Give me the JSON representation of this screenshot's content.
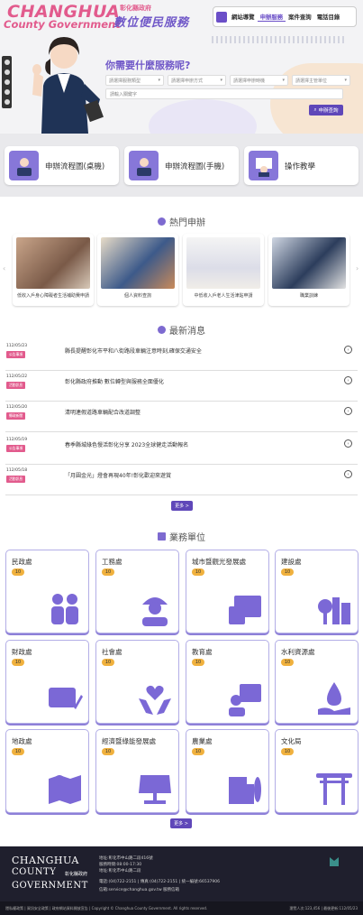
{
  "header": {
    "logo_en_line1": "CHANGHUA",
    "logo_en_line2": "County Government",
    "logo_zh_small": "彰化縣政府",
    "logo_zh_big": "數位便民服務",
    "nav": [
      "網站導覽",
      "申辦服務",
      "案件查詢",
      "電話目錄"
    ]
  },
  "search": {
    "question": "你需要什麼服務呢?",
    "selects": [
      "請選擇服務類型",
      "請選擇申辦方式",
      "請選擇申辦時機",
      "請選擇主管單位"
    ],
    "keyword_placeholder": "請輸入關鍵字",
    "button_label": "申辦查詢"
  },
  "quick_cards": [
    {
      "label": "申辦流程圖(桌機)"
    },
    {
      "label": "申辦流程圖(手機)"
    },
    {
      "label": "操作教學"
    }
  ],
  "hot": {
    "title": "熱門申辦",
    "items": [
      {
        "label": "低收入戶身心障礙者生活補助費申請"
      },
      {
        "label": "個人資料查詢"
      },
      {
        "label": "中低收入戶老人生活津貼申請"
      },
      {
        "label": "職業訓練"
      }
    ]
  },
  "news": {
    "title": "最新消息",
    "items": [
      {
        "date": "112/05/23",
        "tag": "公告事項",
        "title": "縣長提醒彰化市平和八街路段車輛注意時刻,確保交通安全"
      },
      {
        "date": "112/05/22",
        "tag": "活動訊息",
        "title": "彰化縣政府推動 數位轉型與服務全面優化"
      },
      {
        "date": "112/05/20",
        "tag": "縣政新聞",
        "title": "清明連假道路車輛配合改道調整"
      },
      {
        "date": "112/05/19",
        "tag": "公告事項",
        "title": "春季縣城綠色慢活彰化分享 2023全球健走活動報名"
      },
      {
        "date": "112/05/18",
        "tag": "活動訊息",
        "title": "「月圓金光」燈會再現40年!彰化歡迎來遊賞"
      }
    ],
    "more_label": "更多 >"
  },
  "units": {
    "title": "業務單位",
    "items": [
      {
        "name": "民政處",
        "count": "10",
        "icon": "family-icon"
      },
      {
        "name": "工務處",
        "count": "10",
        "icon": "worker-icon"
      },
      {
        "name": "城市暨觀光發展處",
        "count": "10",
        "icon": "landscape-icon"
      },
      {
        "name": "建設處",
        "count": "10",
        "icon": "city-icon"
      },
      {
        "name": "財政處",
        "count": "10",
        "icon": "money-icon"
      },
      {
        "name": "社會處",
        "count": "10",
        "icon": "care-icon"
      },
      {
        "name": "教育處",
        "count": "10",
        "icon": "teacher-icon"
      },
      {
        "name": "水利資源處",
        "count": "10",
        "icon": "water-icon"
      },
      {
        "name": "地政處",
        "count": "10",
        "icon": "map-icon"
      },
      {
        "name": "經濟暨綠能發展處",
        "count": "10",
        "icon": "solar-icon"
      },
      {
        "name": "農業處",
        "count": "10",
        "icon": "farm-icon"
      },
      {
        "name": "文化局",
        "count": "10",
        "icon": "gate-icon"
      }
    ],
    "more_label": "更多 >"
  },
  "footer": {
    "en": [
      "CHANGHUA",
      "COUNTY",
      "GOVERNMENT"
    ],
    "zh": "彰化縣政府",
    "info": [
      "地址:彰化市中山路二段416號",
      "服務時間:08:00-17:30",
      "地址:彰化市中山路二段",
      "電話:(04)722-2151 | 傳真:(04)722-2151 | 統一編號:66537906",
      "信箱:service@changhua.gov.tw 服務信箱"
    ],
    "bottom_left": "隱私權政策 | 資訊安全政策 | 政府網站資料開放宣告 | Copyright © Changhua County Government. All rights reserved.",
    "bottom_right": "瀏覽人次:123,456 | 最後更新:112/05/23"
  }
}
